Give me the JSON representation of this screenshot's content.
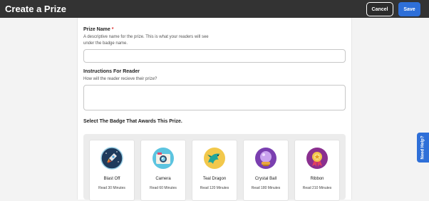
{
  "header": {
    "title": "Create a Prize",
    "cancel_label": "Cancel",
    "save_label": "Save"
  },
  "form": {
    "prize_name": {
      "label": "Prize Name",
      "required_mark": "*",
      "help": "A descriptive name for the prize. This is what your readers will see under the badge name.",
      "value": ""
    },
    "instructions": {
      "label": "Instructions For Reader",
      "help": "How will the reader recieve their prize?",
      "value": ""
    },
    "badge_section_label": "Select The Badge That Awards This Prize."
  },
  "badges": [
    {
      "name": "Blast Off",
      "read": "Read 30 Minutes",
      "icon": "rocket-icon"
    },
    {
      "name": "Camera",
      "read": "Read 60 Minutes",
      "icon": "camera-icon"
    },
    {
      "name": "Teal Dragon",
      "read": "Read 120 Minutes",
      "icon": "dragon-icon"
    },
    {
      "name": "Crystal Ball",
      "read": "Read 180 Minutes",
      "icon": "crystal-ball-icon"
    },
    {
      "name": "Ribbon",
      "read": "Read 210 Minutes",
      "icon": "ribbon-icon"
    }
  ],
  "help_tab": {
    "label": "Need Help?"
  },
  "colors": {
    "topbar": "#333333",
    "accent": "#2e6fd8",
    "required": "#dd3333"
  }
}
